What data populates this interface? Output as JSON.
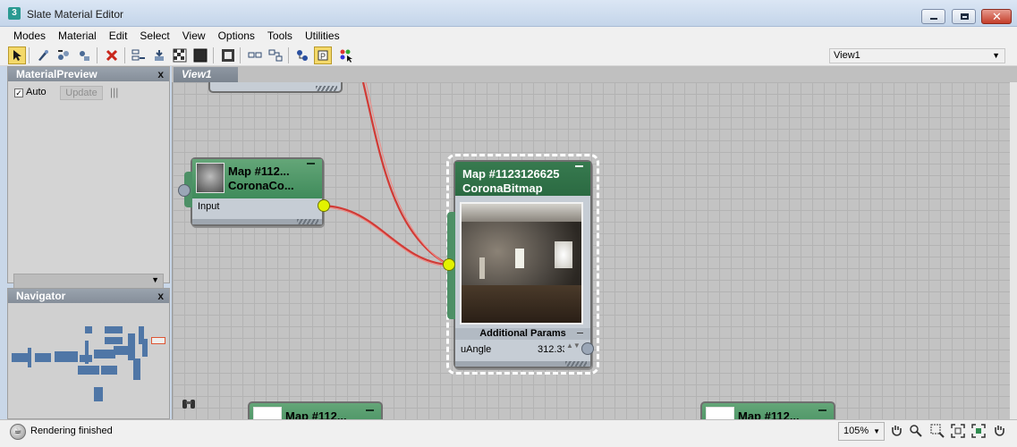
{
  "window": {
    "title": "Slate Material Editor",
    "app_icon_glyph": "3",
    "close_glyph": "✕"
  },
  "menu": [
    "Modes",
    "Material",
    "Edit",
    "Select",
    "View",
    "Options",
    "Tools",
    "Utilities"
  ],
  "toolbar": {
    "view_select": "View1",
    "view_select_arrow": "▼",
    "icons": [
      "select-arrow-icon",
      "pick-material-icon",
      "put-to-scene-icon",
      "assign-to-selection-icon",
      "delete-icon",
      "move-children-icon",
      "hide-unused-nodeslots-icon",
      "background-checker-icon",
      "background-dark-icon",
      "show-map-in-viewport-icon",
      "layout-all-icon",
      "layout-children-icon",
      "material-map-navigator-icon",
      "parameter-editor-icon",
      "select-by-material-icon"
    ]
  },
  "material_preview": {
    "title": "MaterialPreview",
    "close": "x",
    "check_mark": "✓",
    "auto_label": "Auto",
    "update_label": "Update",
    "options_glyph": "|||",
    "dropdown_arrow": "▼"
  },
  "navigator": {
    "title": "Navigator",
    "close": "x"
  },
  "view_tab": {
    "label": "View1"
  },
  "nodes": {
    "small": {
      "title": "Map #112...",
      "subtitle": "CoronaCo...",
      "input_label": "Input"
    },
    "big": {
      "title": "Map #1123126625",
      "subtitle": "CoronaBitmap",
      "section": "Additional Params",
      "param_label": "uAngle",
      "param_value": "312.33",
      "spinner": "▲▼"
    },
    "bottom_left": {
      "title": "Map #112..."
    },
    "bottom_right": {
      "title": "Map #112..."
    }
  },
  "status": {
    "text": "Rendering finished",
    "zoom": "105%",
    "zoom_arrow": "▼",
    "icons": [
      "pan-hand-icon",
      "zoom-icon",
      "zoom-region-icon",
      "zoom-extents-icon",
      "zoom-extents-selected-icon",
      "pan-to-selected-icon"
    ]
  },
  "colors": {
    "node_header": "#4f9a6a",
    "selected_node_header": "#2f7246",
    "wire": "#d23a35",
    "socket_output": "#e2f200",
    "active_tool": "#f4d96a"
  }
}
